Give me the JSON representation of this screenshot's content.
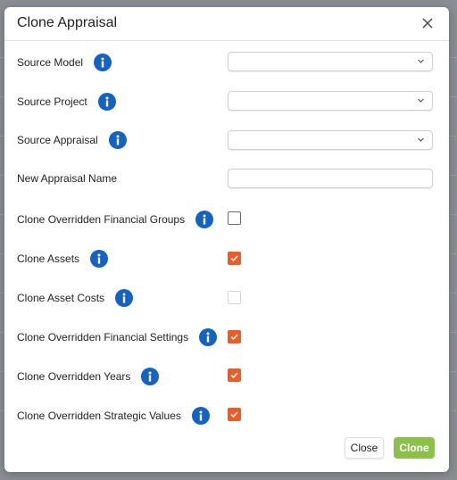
{
  "dialog": {
    "title": "Clone Appraisal",
    "close_icon": "close-icon"
  },
  "fields": {
    "source_model": {
      "label": "Source Model",
      "value": ""
    },
    "source_project": {
      "label": "Source Project",
      "value": ""
    },
    "source_appraisal": {
      "label": "Source Appraisal",
      "value": ""
    },
    "new_appraisal_name": {
      "label": "New Appraisal Name",
      "value": ""
    }
  },
  "options": {
    "clone_overridden_financial_groups": {
      "label": "Clone Overridden Financial Groups",
      "checked": false
    },
    "clone_assets": {
      "label": "Clone Assets",
      "checked": true
    },
    "clone_asset_costs": {
      "label": "Clone Asset Costs",
      "checked": false,
      "disabled": true
    },
    "clone_overridden_financial_settings": {
      "label": "Clone Overridden Financial Settings",
      "checked": true
    },
    "clone_overridden_years": {
      "label": "Clone Overridden Years",
      "checked": true
    },
    "clone_overridden_strategic_values": {
      "label": "Clone Overridden Strategic Values",
      "checked": true
    }
  },
  "buttons": {
    "close": "Close",
    "clone": "Clone"
  },
  "colors": {
    "accent_orange": "#f05a24",
    "info_blue": "#1462c4",
    "clone_green": "#8dc04a"
  }
}
